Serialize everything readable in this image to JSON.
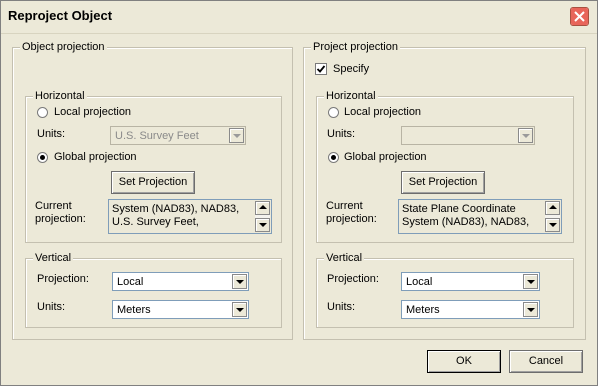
{
  "window": {
    "title": "Reproject Object"
  },
  "object_projection": {
    "group_label": "Object projection",
    "horizontal": {
      "label": "Horizontal",
      "local_projection": "Local projection",
      "units_label": "Units:",
      "units_value": "U.S. Survey Feet",
      "global_projection": "Global projection",
      "selected": "Global projection",
      "set_projection_button": "Set Projection",
      "current_projection_label_1": "Current",
      "current_projection_label_2": "projection:",
      "current_projection_line_1": "System (NAD83), NAD83,",
      "current_projection_line_2": "U.S. Survey Feet,"
    },
    "vertical": {
      "label": "Vertical",
      "projection_label": "Projection:",
      "projection_value": "Local",
      "units_label": "Units:",
      "units_value": "Meters"
    }
  },
  "project_projection": {
    "group_label": "Project projection",
    "specify_label": "Specify",
    "specify_checked": true,
    "horizontal": {
      "label": "Horizontal",
      "local_projection": "Local projection",
      "units_label": "Units:",
      "units_value": "",
      "global_projection": "Global projection",
      "selected": "Global projection",
      "set_projection_button": "Set Projection",
      "current_projection_label_1": "Current",
      "current_projection_label_2": "projection:",
      "current_projection_line_1": "State Plane Coordinate",
      "current_projection_line_2": "System (NAD83), NAD83,"
    },
    "vertical": {
      "label": "Vertical",
      "projection_label": "Projection:",
      "projection_value": "Local",
      "units_label": "Units:",
      "units_value": "Meters"
    }
  },
  "buttons": {
    "ok": "OK",
    "cancel": "Cancel"
  }
}
